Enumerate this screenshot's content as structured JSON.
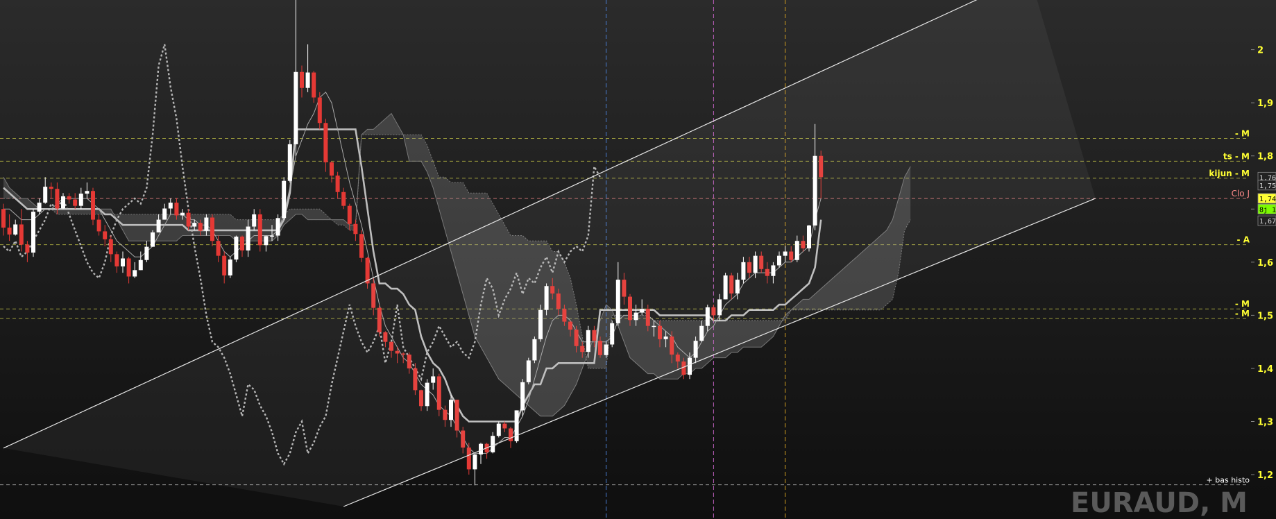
{
  "chart_data": {
    "type": "candlestick",
    "title": "EURAUD, M",
    "ylim": [
      1.14,
      2.07
    ],
    "y_ticks": [
      "1,2",
      "1,3",
      "1,4",
      "1,5",
      "1,6",
      "1,7",
      "1,8",
      "1,9",
      "2"
    ],
    "y_tick_values": [
      1.2,
      1.3,
      1.4,
      1.5,
      1.6,
      1.7,
      1.8,
      1.9,
      2.0
    ],
    "price_tags": [
      {
        "label": "1,76",
        "value": 1.76,
        "color": "#ffffff"
      },
      {
        "label": "1,75",
        "value": 1.745,
        "color": "#ffffff"
      },
      {
        "label": "1,74",
        "value": 1.72,
        "color": "#ffff33"
      },
      {
        "label": "8j 1",
        "value": 1.7,
        "color": "#7CFC00"
      },
      {
        "label": "1,67",
        "value": 1.678,
        "color": "#ffffff"
      }
    ],
    "horizontal_levels": [
      {
        "label": "- M",
        "value": 1.833,
        "color": "#c8c846",
        "style": "dashed"
      },
      {
        "label": "ts - M",
        "value": 1.79,
        "color": "#c8c846",
        "style": "dashed"
      },
      {
        "label": "kijun - M",
        "value": 1.758,
        "color": "#c8c846",
        "style": "dashed"
      },
      {
        "label": "Clo J",
        "value": 1.72,
        "color": "#ff8a8a",
        "style": "dashed"
      },
      {
        "label": "- A",
        "value": 1.633,
        "color": "#c8c846",
        "style": "dashed"
      },
      {
        "label": "- M",
        "value": 1.512,
        "color": "#c8c846",
        "style": "dashed"
      },
      {
        "label": "- M",
        "value": 1.494,
        "color": "#c8c846",
        "style": "dashed"
      },
      {
        "label": "+ bas histo",
        "value": 1.181,
        "color": "#bbbbbb",
        "style": "dashed"
      }
    ],
    "vertical_markers": [
      {
        "index": 101,
        "color": "#4a7fd6"
      },
      {
        "index": 119,
        "color": "#c060c0"
      },
      {
        "index": 131,
        "color": "#d4a020"
      }
    ],
    "channel": {
      "upper": [
        [
          0,
          1.25
        ],
        [
          172,
          2.14
        ]
      ],
      "lower": [
        [
          57,
          1.14
        ],
        [
          183,
          1.72
        ]
      ]
    },
    "seed_open": 1.7,
    "candles_close": [
      1.665,
      1.652,
      1.671,
      1.633,
      1.618,
      1.695,
      1.712,
      1.742,
      1.738,
      1.701,
      1.724,
      1.718,
      1.706,
      1.729,
      1.734,
      1.68,
      1.658,
      1.643,
      1.615,
      1.592,
      1.607,
      1.573,
      1.585,
      1.604,
      1.629,
      1.656,
      1.68,
      1.701,
      1.712,
      1.688,
      1.693,
      1.667,
      1.674,
      1.659,
      1.684,
      1.64,
      1.612,
      1.575,
      1.605,
      1.648,
      1.622,
      1.667,
      1.69,
      1.632,
      1.649,
      1.65,
      1.683,
      1.753,
      1.822,
      1.958,
      1.928,
      1.957,
      1.91,
      1.862,
      1.788,
      1.763,
      1.732,
      1.706,
      1.672,
      1.653,
      1.608,
      1.56,
      1.514,
      1.468,
      1.45,
      1.433,
      1.428,
      1.426,
      1.4,
      1.359,
      1.329,
      1.373,
      1.385,
      1.322,
      1.303,
      1.341,
      1.283,
      1.251,
      1.21,
      1.238,
      1.258,
      1.242,
      1.273,
      1.296,
      1.287,
      1.263,
      1.321,
      1.374,
      1.415,
      1.455,
      1.51,
      1.555,
      1.541,
      1.512,
      1.488,
      1.473,
      1.442,
      1.431,
      1.472,
      1.452,
      1.425,
      1.445,
      1.485,
      1.567,
      1.535,
      1.491,
      1.505,
      1.512,
      1.48,
      1.48,
      1.455,
      1.46,
      1.426,
      1.413,
      1.388,
      1.42,
      1.452,
      1.48,
      1.515,
      1.5,
      1.53,
      1.575,
      1.541,
      1.567,
      1.6,
      1.58,
      1.612,
      1.587,
      1.574,
      1.594,
      1.612,
      1.62,
      1.604,
      1.64,
      1.626,
      1.669,
      1.8,
      1.76
    ],
    "candles_high": [
      1.71,
      1.69,
      1.68,
      1.7,
      1.64,
      1.7,
      1.72,
      1.76,
      1.75,
      1.75,
      1.73,
      1.73,
      1.73,
      1.74,
      1.75,
      1.74,
      1.69,
      1.67,
      1.65,
      1.62,
      1.62,
      1.61,
      1.6,
      1.62,
      1.64,
      1.66,
      1.69,
      1.71,
      1.72,
      1.72,
      1.7,
      1.7,
      1.68,
      1.68,
      1.69,
      1.69,
      1.65,
      1.62,
      1.61,
      1.65,
      1.65,
      1.68,
      1.7,
      1.7,
      1.65,
      1.67,
      1.69,
      1.76,
      1.83,
      2.14,
      1.97,
      2.01,
      1.96,
      1.92,
      1.87,
      1.79,
      1.77,
      1.74,
      1.71,
      1.68,
      1.66,
      1.61,
      1.57,
      1.52,
      1.47,
      1.45,
      1.44,
      1.43,
      1.43,
      1.41,
      1.36,
      1.38,
      1.4,
      1.39,
      1.33,
      1.35,
      1.34,
      1.29,
      1.26,
      1.24,
      1.26,
      1.26,
      1.28,
      1.3,
      1.3,
      1.29,
      1.32,
      1.38,
      1.42,
      1.46,
      1.52,
      1.56,
      1.57,
      1.55,
      1.52,
      1.49,
      1.48,
      1.45,
      1.48,
      1.48,
      1.46,
      1.45,
      1.49,
      1.6,
      1.58,
      1.54,
      1.52,
      1.53,
      1.52,
      1.49,
      1.49,
      1.47,
      1.47,
      1.43,
      1.42,
      1.43,
      1.46,
      1.49,
      1.52,
      1.52,
      1.54,
      1.58,
      1.58,
      1.58,
      1.61,
      1.61,
      1.62,
      1.62,
      1.6,
      1.6,
      1.62,
      1.63,
      1.63,
      1.65,
      1.65,
      1.67,
      1.86,
      1.81
    ],
    "candles_low": [
      1.65,
      1.64,
      1.65,
      1.62,
      1.6,
      1.61,
      1.69,
      1.71,
      1.72,
      1.69,
      1.7,
      1.71,
      1.7,
      1.7,
      1.72,
      1.67,
      1.65,
      1.63,
      1.6,
      1.58,
      1.58,
      1.56,
      1.57,
      1.59,
      1.6,
      1.65,
      1.67,
      1.69,
      1.69,
      1.68,
      1.68,
      1.66,
      1.66,
      1.65,
      1.65,
      1.63,
      1.6,
      1.56,
      1.57,
      1.6,
      1.61,
      1.61,
      1.66,
      1.62,
      1.62,
      1.64,
      1.64,
      1.68,
      1.75,
      1.8,
      1.91,
      1.92,
      1.9,
      1.85,
      1.77,
      1.75,
      1.72,
      1.7,
      1.66,
      1.64,
      1.6,
      1.55,
      1.5,
      1.46,
      1.44,
      1.42,
      1.41,
      1.41,
      1.39,
      1.35,
      1.32,
      1.32,
      1.36,
      1.31,
      1.29,
      1.29,
      1.27,
      1.24,
      1.2,
      1.18,
      1.22,
      1.23,
      1.24,
      1.27,
      1.28,
      1.25,
      1.26,
      1.31,
      1.37,
      1.41,
      1.45,
      1.5,
      1.53,
      1.5,
      1.48,
      1.46,
      1.43,
      1.42,
      1.42,
      1.44,
      1.42,
      1.42,
      1.44,
      1.48,
      1.52,
      1.48,
      1.48,
      1.5,
      1.47,
      1.46,
      1.44,
      1.44,
      1.41,
      1.4,
      1.38,
      1.38,
      1.41,
      1.45,
      1.47,
      1.49,
      1.49,
      1.53,
      1.53,
      1.53,
      1.56,
      1.57,
      1.57,
      1.58,
      1.56,
      1.56,
      1.59,
      1.6,
      1.6,
      1.6,
      1.62,
      1.62,
      1.66,
      1.72
    ],
    "tenkan": [
      1.7,
      1.7,
      1.69,
      1.68,
      1.68,
      1.68,
      1.69,
      1.7,
      1.7,
      1.71,
      1.72,
      1.72,
      1.72,
      1.72,
      1.72,
      1.71,
      1.7,
      1.68,
      1.66,
      1.64,
      1.63,
      1.62,
      1.61,
      1.61,
      1.62,
      1.63,
      1.65,
      1.67,
      1.69,
      1.69,
      1.69,
      1.68,
      1.68,
      1.67,
      1.67,
      1.66,
      1.64,
      1.62,
      1.61,
      1.62,
      1.63,
      1.64,
      1.65,
      1.65,
      1.65,
      1.65,
      1.66,
      1.69,
      1.74,
      1.8,
      1.83,
      1.86,
      1.88,
      1.91,
      1.92,
      1.9,
      1.85,
      1.8,
      1.75,
      1.71,
      1.67,
      1.62,
      1.57,
      1.52,
      1.48,
      1.46,
      1.44,
      1.42,
      1.41,
      1.39,
      1.37,
      1.36,
      1.35,
      1.33,
      1.32,
      1.31,
      1.29,
      1.27,
      1.25,
      1.24,
      1.24,
      1.24,
      1.25,
      1.26,
      1.27,
      1.27,
      1.29,
      1.31,
      1.34,
      1.38,
      1.42,
      1.46,
      1.49,
      1.5,
      1.5,
      1.49,
      1.47,
      1.45,
      1.45,
      1.45,
      1.45,
      1.45,
      1.46,
      1.49,
      1.5,
      1.5,
      1.5,
      1.51,
      1.5,
      1.49,
      1.48,
      1.47,
      1.46,
      1.44,
      1.43,
      1.42,
      1.43,
      1.45,
      1.47,
      1.48,
      1.5,
      1.52,
      1.53,
      1.54,
      1.56,
      1.57,
      1.58,
      1.58,
      1.58,
      1.58,
      1.59,
      1.6,
      1.6,
      1.61,
      1.62,
      1.63,
      1.68,
      1.72
    ],
    "kijun": [
      1.74,
      1.73,
      1.72,
      1.71,
      1.7,
      1.7,
      1.7,
      1.7,
      1.7,
      1.7,
      1.7,
      1.7,
      1.7,
      1.7,
      1.7,
      1.7,
      1.7,
      1.69,
      1.69,
      1.68,
      1.67,
      1.67,
      1.67,
      1.67,
      1.67,
      1.67,
      1.67,
      1.67,
      1.67,
      1.67,
      1.67,
      1.66,
      1.66,
      1.66,
      1.66,
      1.66,
      1.66,
      1.66,
      1.66,
      1.66,
      1.66,
      1.66,
      1.66,
      1.66,
      1.66,
      1.66,
      1.66,
      1.68,
      1.73,
      1.85,
      1.85,
      1.85,
      1.85,
      1.85,
      1.85,
      1.85,
      1.85,
      1.85,
      1.85,
      1.85,
      1.78,
      1.7,
      1.62,
      1.56,
      1.56,
      1.55,
      1.55,
      1.54,
      1.52,
      1.51,
      1.46,
      1.43,
      1.41,
      1.4,
      1.38,
      1.35,
      1.33,
      1.31,
      1.3,
      1.3,
      1.3,
      1.3,
      1.3,
      1.3,
      1.3,
      1.3,
      1.3,
      1.33,
      1.35,
      1.37,
      1.37,
      1.4,
      1.4,
      1.41,
      1.41,
      1.41,
      1.41,
      1.41,
      1.41,
      1.41,
      1.51,
      1.51,
      1.51,
      1.51,
      1.51,
      1.51,
      1.51,
      1.51,
      1.51,
      1.51,
      1.5,
      1.5,
      1.5,
      1.5,
      1.5,
      1.5,
      1.5,
      1.5,
      1.5,
      1.49,
      1.49,
      1.49,
      1.5,
      1.5,
      1.5,
      1.51,
      1.51,
      1.51,
      1.51,
      1.51,
      1.52,
      1.52,
      1.53,
      1.54,
      1.55,
      1.56,
      1.59,
      1.68
    ],
    "senkou_a": [
      1.76,
      1.74,
      1.73,
      1.72,
      1.72,
      1.71,
      1.7,
      1.7,
      1.7,
      1.7,
      1.7,
      1.7,
      1.7,
      1.7,
      1.7,
      1.7,
      1.7,
      1.7,
      1.7,
      1.68,
      1.66,
      1.64,
      1.64,
      1.64,
      1.64,
      1.64,
      1.64,
      1.64,
      1.64,
      1.64,
      1.65,
      1.65,
      1.65,
      1.65,
      1.65,
      1.65,
      1.65,
      1.65,
      1.65,
      1.64,
      1.64,
      1.64,
      1.64,
      1.64,
      1.64,
      1.64,
      1.65,
      1.67,
      1.68,
      1.69,
      1.69,
      1.68,
      1.68,
      1.68,
      1.68,
      1.68,
      1.68,
      1.68,
      1.67,
      1.67,
      1.84,
      1.85,
      1.85,
      1.86,
      1.87,
      1.88,
      1.86,
      1.84,
      1.79,
      1.79,
      1.79,
      1.77,
      1.74,
      1.7,
      1.66,
      1.62,
      1.58,
      1.54,
      1.5,
      1.46,
      1.44,
      1.42,
      1.4,
      1.38,
      1.37,
      1.36,
      1.35,
      1.34,
      1.33,
      1.32,
      1.31,
      1.31,
      1.31,
      1.32,
      1.33,
      1.35,
      1.37,
      1.4,
      1.43,
      1.46,
      1.49,
      1.52,
      1.51,
      1.48,
      1.45,
      1.42,
      1.41,
      1.4,
      1.39,
      1.39,
      1.38,
      1.38,
      1.38,
      1.38,
      1.39,
      1.39,
      1.4,
      1.4,
      1.41,
      1.42,
      1.42,
      1.42,
      1.43,
      1.43,
      1.44,
      1.44,
      1.44,
      1.44,
      1.45,
      1.46,
      1.48,
      1.5,
      1.51,
      1.52,
      1.53,
      1.53,
      1.54,
      1.55,
      1.56,
      1.57,
      1.58,
      1.59,
      1.6,
      1.61,
      1.62,
      1.63,
      1.64,
      1.65,
      1.66,
      1.68,
      1.72,
      1.76,
      1.78
    ],
    "senkou_b": [
      1.72,
      1.72,
      1.72,
      1.71,
      1.7,
      1.7,
      1.7,
      1.7,
      1.7,
      1.69,
      1.69,
      1.69,
      1.69,
      1.69,
      1.69,
      1.69,
      1.69,
      1.69,
      1.69,
      1.69,
      1.69,
      1.69,
      1.69,
      1.69,
      1.69,
      1.69,
      1.69,
      1.69,
      1.69,
      1.69,
      1.69,
      1.69,
      1.69,
      1.69,
      1.69,
      1.69,
      1.69,
      1.69,
      1.69,
      1.68,
      1.68,
      1.68,
      1.68,
      1.68,
      1.68,
      1.68,
      1.68,
      1.69,
      1.7,
      1.7,
      1.7,
      1.7,
      1.7,
      1.7,
      1.69,
      1.68,
      1.67,
      1.67,
      1.66,
      1.66,
      1.84,
      1.84,
      1.84,
      1.84,
      1.84,
      1.84,
      1.84,
      1.84,
      1.84,
      1.84,
      1.84,
      1.82,
      1.79,
      1.76,
      1.76,
      1.75,
      1.75,
      1.75,
      1.73,
      1.73,
      1.73,
      1.73,
      1.71,
      1.69,
      1.67,
      1.65,
      1.65,
      1.65,
      1.64,
      1.64,
      1.64,
      1.64,
      1.62,
      1.62,
      1.6,
      1.57,
      1.52,
      1.46,
      1.4,
      1.4,
      1.4,
      1.4,
      1.5,
      1.5,
      1.5,
      1.5,
      1.5,
      1.5,
      1.5,
      1.49,
      1.49,
      1.49,
      1.49,
      1.49,
      1.49,
      1.49,
      1.49,
      1.49,
      1.49,
      1.49,
      1.49,
      1.49,
      1.49,
      1.49,
      1.49,
      1.49,
      1.49,
      1.49,
      1.49,
      1.49,
      1.49,
      1.49,
      1.51,
      1.51,
      1.51,
      1.51,
      1.51,
      1.51,
      1.51,
      1.51,
      1.51,
      1.51,
      1.51,
      1.51,
      1.51,
      1.51,
      1.51,
      1.51,
      1.52,
      1.53,
      1.58,
      1.66,
      1.68
    ],
    "chikou": [
      1.63,
      1.62,
      1.64,
      1.61,
      1.62,
      1.64,
      1.66,
      1.68,
      1.71,
      1.7,
      1.72,
      1.69,
      1.66,
      1.63,
      1.6,
      1.58,
      1.57,
      1.6,
      1.65,
      1.68,
      1.7,
      1.71,
      1.72,
      1.71,
      1.74,
      1.84,
      1.97,
      2.01,
      1.93,
      1.87,
      1.78,
      1.7,
      1.63,
      1.57,
      1.5,
      1.45,
      1.44,
      1.42,
      1.39,
      1.35,
      1.31,
      1.37,
      1.36,
      1.33,
      1.31,
      1.28,
      1.24,
      1.22,
      1.24,
      1.28,
      1.3,
      1.24,
      1.26,
      1.29,
      1.31,
      1.37,
      1.42,
      1.47,
      1.52,
      1.48,
      1.45,
      1.43,
      1.45,
      1.48,
      1.41,
      1.45,
      1.52,
      1.44,
      1.42,
      1.4,
      1.38,
      1.43,
      1.45,
      1.48,
      1.46,
      1.44,
      1.45,
      1.43,
      1.42,
      1.45,
      1.52,
      1.57,
      1.55,
      1.5,
      1.53,
      1.55,
      1.58,
      1.54,
      1.57,
      1.56,
      1.59,
      1.61,
      1.58,
      1.62,
      1.6,
      1.62,
      1.63,
      1.62,
      1.65,
      1.78,
      1.76
    ]
  }
}
